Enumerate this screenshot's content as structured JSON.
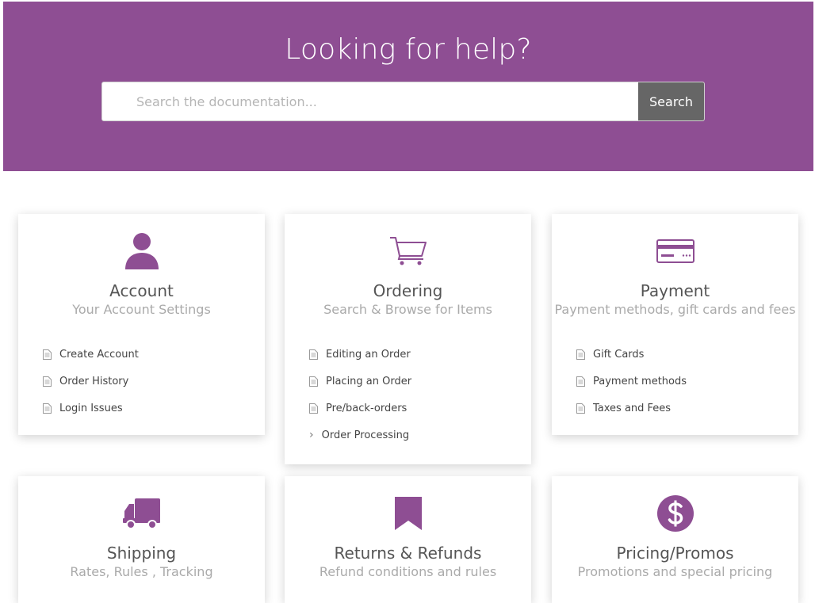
{
  "hero": {
    "title": "Looking for help?",
    "search_placeholder": "Search the documentation...",
    "search_button": "Search"
  },
  "colors": {
    "brand": "#8e4e93",
    "search_button": "#666666"
  },
  "cards": [
    {
      "icon": "person-icon",
      "title": "Account",
      "subtitle": "Your Account Settings",
      "links": [
        "Create Account",
        "Order History",
        "Login Issues"
      ]
    },
    {
      "icon": "shopping-cart-icon",
      "title": "Ordering",
      "subtitle": "Search & Browse for Items",
      "links": [
        "Editing an Order",
        "Placing an Order",
        "Pre/back-orders"
      ],
      "more": "Order Processing"
    },
    {
      "icon": "credit-card-icon",
      "title": "Payment",
      "subtitle": "Payment methods, gift cards and fees",
      "links": [
        "Gift Cards",
        "Payment methods",
        "Taxes and Fees"
      ]
    },
    {
      "icon": "truck-icon",
      "title": "Shipping",
      "subtitle": "Rates, Rules , Tracking"
    },
    {
      "icon": "bookmark-icon",
      "title": "Returns & Refunds",
      "subtitle": "Refund conditions and rules"
    },
    {
      "icon": "dollar-icon",
      "title": "Pricing/Promos",
      "subtitle": "Promotions and special pricing"
    }
  ]
}
